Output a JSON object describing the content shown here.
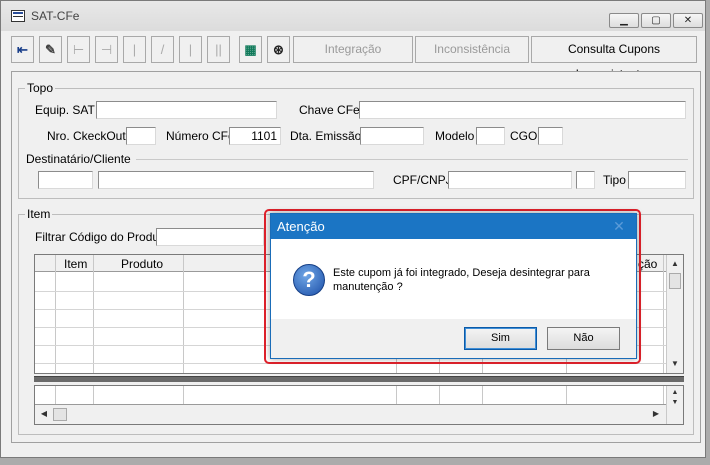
{
  "window": {
    "title": "SAT-CFe"
  },
  "toolbar": {
    "btn_integracao": "Integração",
    "btn_inconsistencia": "Inconsistência",
    "btn_consulta": "Consulta Cupons Inconsistentes"
  },
  "topo": {
    "legend": "Topo",
    "equip_sat_label": "Equip. SAT",
    "chave_cfe_label": "Chave CFe",
    "nro_checkout_label": "Nro. CkeckOut",
    "numero_cfe_label": "Número CFe",
    "numero_cfe_value": "1101",
    "dta_emissao_label": "Dta. Emissão",
    "modelo_label": "Modelo",
    "cgo_label": "CGO",
    "destinatario_legend": "Destinatário/Cliente",
    "cpf_cnpj_label": "CPF/CNPJ",
    "tipo_label": "Tipo"
  },
  "item": {
    "legend": "Item",
    "filtrar_label": "Filtrar Código do Produto",
    "columns": [
      "Item",
      "Produto",
      "ção"
    ]
  },
  "dialog": {
    "title": "Atenção",
    "message": "Este cupom já foi integrado, Deseja desintegrar para manutenção ?",
    "btn_yes": "Sim",
    "btn_no": "Não"
  }
}
